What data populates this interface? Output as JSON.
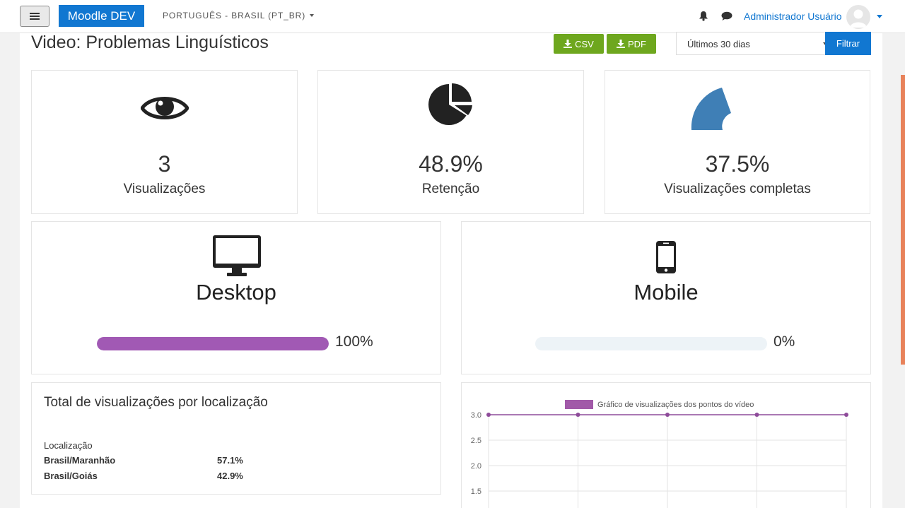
{
  "navbar": {
    "brand": "Moodle DEV",
    "language": "PORTUGUÊS - BRASIL (PT_BR)",
    "user_name": "Administrador Usuário"
  },
  "header": {
    "title": "Video: Problemas Linguísticos",
    "csv_label": "CSV",
    "pdf_label": "PDF",
    "period_value": "Últimos 30 dias",
    "filter_label": "Filtrar"
  },
  "stats": {
    "views": {
      "value": "3",
      "label": "Visualizações",
      "icon": "eye-icon"
    },
    "retention": {
      "value": "48.9%",
      "label": "Retenção",
      "icon": "pie-chart-icon",
      "fraction": 0.489
    },
    "complete": {
      "value": "37.5%",
      "label": "Visualizações completas",
      "icon": "arc-icon",
      "fraction": 0.375
    }
  },
  "devices": {
    "desktop": {
      "label": "Desktop",
      "percent": "100%",
      "fraction": 1.0,
      "color": "#a159b4",
      "icon": "desktop-icon"
    },
    "mobile": {
      "label": "Mobile",
      "percent": "0%",
      "fraction": 0.0,
      "color": "#a159b4",
      "icon": "mobile-icon"
    }
  },
  "location": {
    "title": "Total de visualizações por localização",
    "column_header": "Localização",
    "rows": [
      {
        "name": "Brasil/Maranhão",
        "pct": "57.1%"
      },
      {
        "name": "Brasil/Goiás",
        "pct": "42.9%"
      }
    ]
  },
  "chart_data": {
    "type": "line",
    "series": [
      {
        "name": "Gráfico de visualizações dos pontos do vídeo",
        "values": [
          3,
          3,
          3,
          3,
          3
        ]
      }
    ],
    "y_tick_labels": [
      "3.0",
      "2.5",
      "2.0",
      "1.5"
    ],
    "ylim": [
      1.5,
      3.0
    ],
    "color": "#8e4b9a",
    "legend_position": "top",
    "grid": true
  },
  "colors": {
    "brand": "#1177d1",
    "export_green": "#6ea71e",
    "pie_dark": "#222222",
    "arc_blue": "#3f7fb6"
  }
}
